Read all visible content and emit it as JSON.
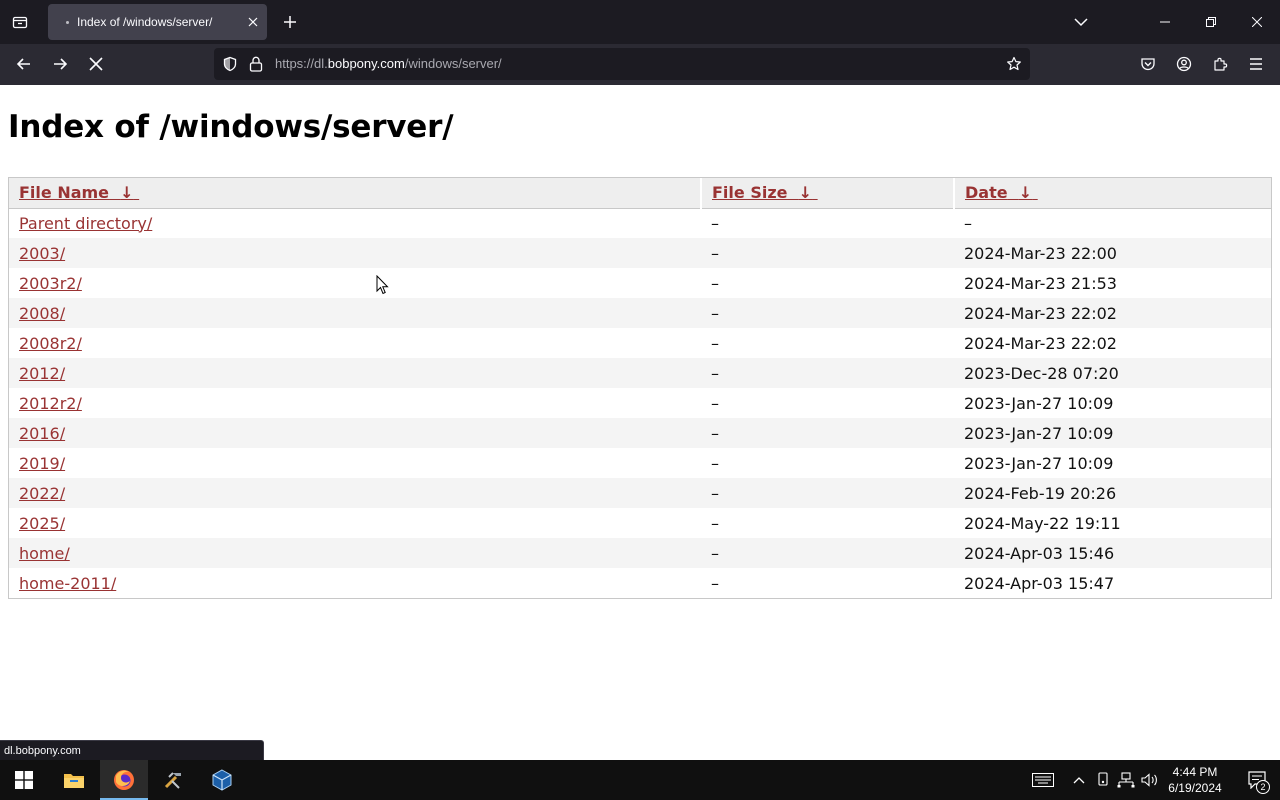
{
  "browser": {
    "tab": {
      "title": "Index of /windows/server/"
    },
    "url": {
      "scheme": "https://",
      "host_prefix": "dl.",
      "host_domain": "bobpony.com",
      "path": "/windows/server/"
    }
  },
  "page": {
    "title": "Index of /windows/server/",
    "headers": {
      "name": "File Name",
      "size": "File Size",
      "date": "Date",
      "sort_arrow": "↓"
    },
    "rows": [
      {
        "name": "Parent directory/",
        "size": "–",
        "date": "–"
      },
      {
        "name": "2003/",
        "size": "–",
        "date": "2024-Mar-23 22:00"
      },
      {
        "name": "2003r2/",
        "size": "–",
        "date": "2024-Mar-23 21:53"
      },
      {
        "name": "2008/",
        "size": "–",
        "date": "2024-Mar-23 22:02"
      },
      {
        "name": "2008r2/",
        "size": "–",
        "date": "2024-Mar-23 22:02"
      },
      {
        "name": "2012/",
        "size": "–",
        "date": "2023-Dec-28 07:20"
      },
      {
        "name": "2012r2/",
        "size": "–",
        "date": "2023-Jan-27 10:09"
      },
      {
        "name": "2016/",
        "size": "–",
        "date": "2023-Jan-27 10:09"
      },
      {
        "name": "2019/",
        "size": "–",
        "date": "2023-Jan-27 10:09"
      },
      {
        "name": "2022/",
        "size": "–",
        "date": "2024-Feb-19 20:26"
      },
      {
        "name": "2025/",
        "size": "–",
        "date": "2024-May-22 19:11"
      },
      {
        "name": "home/",
        "size": "–",
        "date": "2024-Apr-03 15:46"
      },
      {
        "name": "home-2011/",
        "size": "–",
        "date": "2024-Apr-03 15:47"
      }
    ],
    "link_color": "#993333"
  },
  "status_bar": {
    "text": "dl.bobpony.com"
  },
  "taskbar": {
    "time": "4:44 PM",
    "date": "6/19/2024",
    "notification_count": "2",
    "apps": [
      "start-icon",
      "file-explorer-icon",
      "firefox-icon",
      "tool-icon",
      "virtualbox-icon"
    ]
  }
}
